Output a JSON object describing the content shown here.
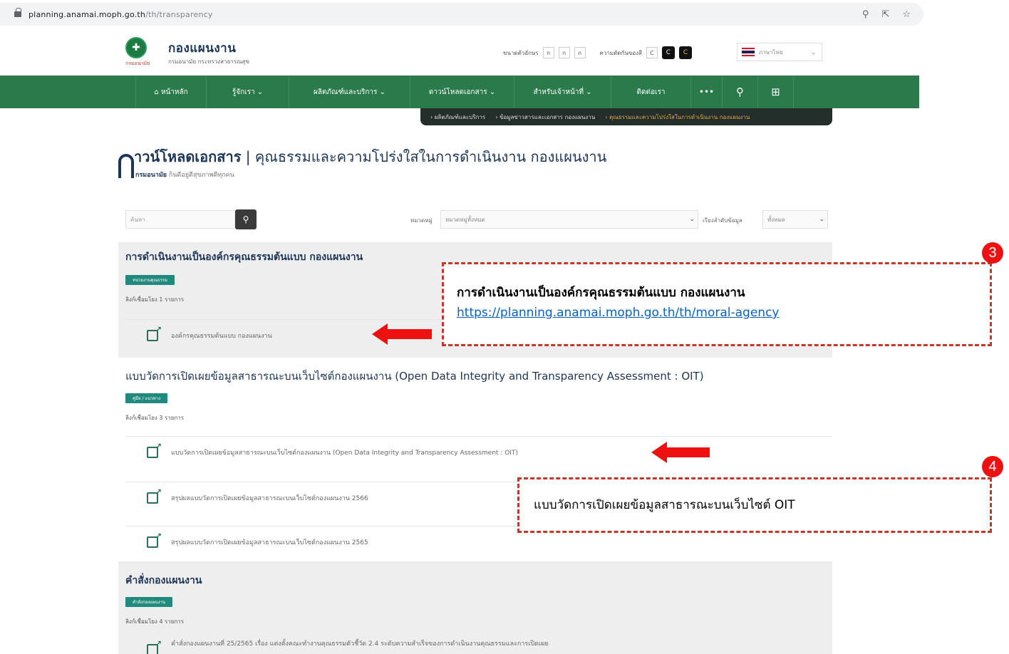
{
  "browser": {
    "url_host": "planning.anamai.moph.go.th",
    "url_path": "/th/transparency",
    "icons": [
      "zoom-icon",
      "share-icon",
      "star-icon"
    ]
  },
  "header": {
    "logo_sub": "กรมอนามัย",
    "title": "กองแผนงาน",
    "subtitle": "กรมอนามัย กระทรวงสาธารณสุข",
    "font_size_label": "ขนาดตัวอักษร",
    "font_small": "ก",
    "font_mid": "ก",
    "font_large": "ก",
    "contrast_label": "ความตัดกันของสี",
    "contrast_normal": "C",
    "contrast_dark": "C",
    "contrast_yellow": "C",
    "language": "ภาษาไทย"
  },
  "nav": {
    "items": [
      "⌂ หน้าหลัก",
      "รู้จักเรา ⌄",
      "ผลิตภัณฑ์และบริการ ⌄",
      "ดาวน์โหลดเอกสาร ⌄",
      "สำหรับเจ้าหน้าที่ ⌄",
      "ติดต่อเรา",
      "•••",
      "⚲",
      "⊞"
    ]
  },
  "breadcrumb": [
    "› ผลิตภัณฑ์และบริการ",
    "› ข้อมูลข่าวสารและเอกสาร กองแผนงาน",
    "› คุณธรรมและความโปร่งใสในการดำเนินงาน กองแผนงาน"
  ],
  "page": {
    "title_bold": "าวน์โหลดเอกสาร",
    "title_rest": " | คุณธรรมและความโปร่งใสในการดำเนินงาน กองแผนงาน",
    "sub_bold": "กรมอนามัย",
    "sub_rest": " กินดีอยู่ดีสุขภาพดีทุกคน"
  },
  "filters": {
    "search_placeholder": "ค้นหา",
    "category_label": "หมวดหมู่",
    "category_value": "หมวดหมู่ทั้งหมด",
    "sort_label": "เรียงลำดับข้อมูล",
    "sort_value": "ทั้งหมด"
  },
  "sections": [
    {
      "title": "การดำเนินงานเป็นองค์กรคุณธรรมต้นแบบ กองแผนงาน",
      "tag": "หน่วยงานคุณธรรม",
      "count": "ลิงก์เชื่อมโยง 1 รายการ",
      "items": [
        "องค์กรคุณธรรมต้นแบบ กองแผนงาน"
      ]
    },
    {
      "title": "แบบวัดการเปิดเผยข้อมูลสาธารณะบนเว็บไซต์กองแผนงาน (Open Data Integrity and Transparency Assessment : OIT)",
      "tag": "คู่มือ / แนวทาง",
      "count": "ลิงก์เชื่อมโยง 3 รายการ",
      "items": [
        "แบบวัดการเปิดเผยข้อมูลสาธารณะบนเว็บไซต์กองแผนงาน (Open Data Integrity and Transparency Assessment : OIT)",
        "สรุปผลแบบวัดการเปิดเผยข้อมูลสาธารณะบนเว็บไซต์กองแผนงาน 2566",
        "สรุปผลแบบวัดการเปิดเผยข้อมูลสาธารณะบนเว็บไซต์กองแผนงาน 2565"
      ]
    },
    {
      "title": "คำสั่งกองแผนงาน",
      "tag": "คำสั่งกองแผนงาน",
      "count": "ลิงก์เชื่อมโยง 4 รายการ",
      "items": [
        "คำสั่งกองแผนงานที่ 25/2565 เรื่อง แต่งตั้งคณะทำงานคุณธรรมตัวชี้วัด 2.4 ระดับความสำเร็จของการดำเนินงานคุณธรรมและการเปิดเผย"
      ]
    }
  ],
  "annotations": [
    {
      "badge": "3",
      "line1": "การดำเนินงานเป็นองค์กรคุณธรรมต้นแบบ กองแผนงาน",
      "line2": "https://planning.anamai.moph.go.th/th/moral-agency"
    },
    {
      "badge": "4",
      "line1": "แบบวัดการเปิดเผยข้อมูลสาธารณะบนเว็บไซต์ OIT"
    }
  ],
  "colors": {
    "nav_green": "#2a7a4c",
    "annotation_red": "#ee1111",
    "tag_teal": "#1f8a7d",
    "link_blue": "#0563c1"
  }
}
